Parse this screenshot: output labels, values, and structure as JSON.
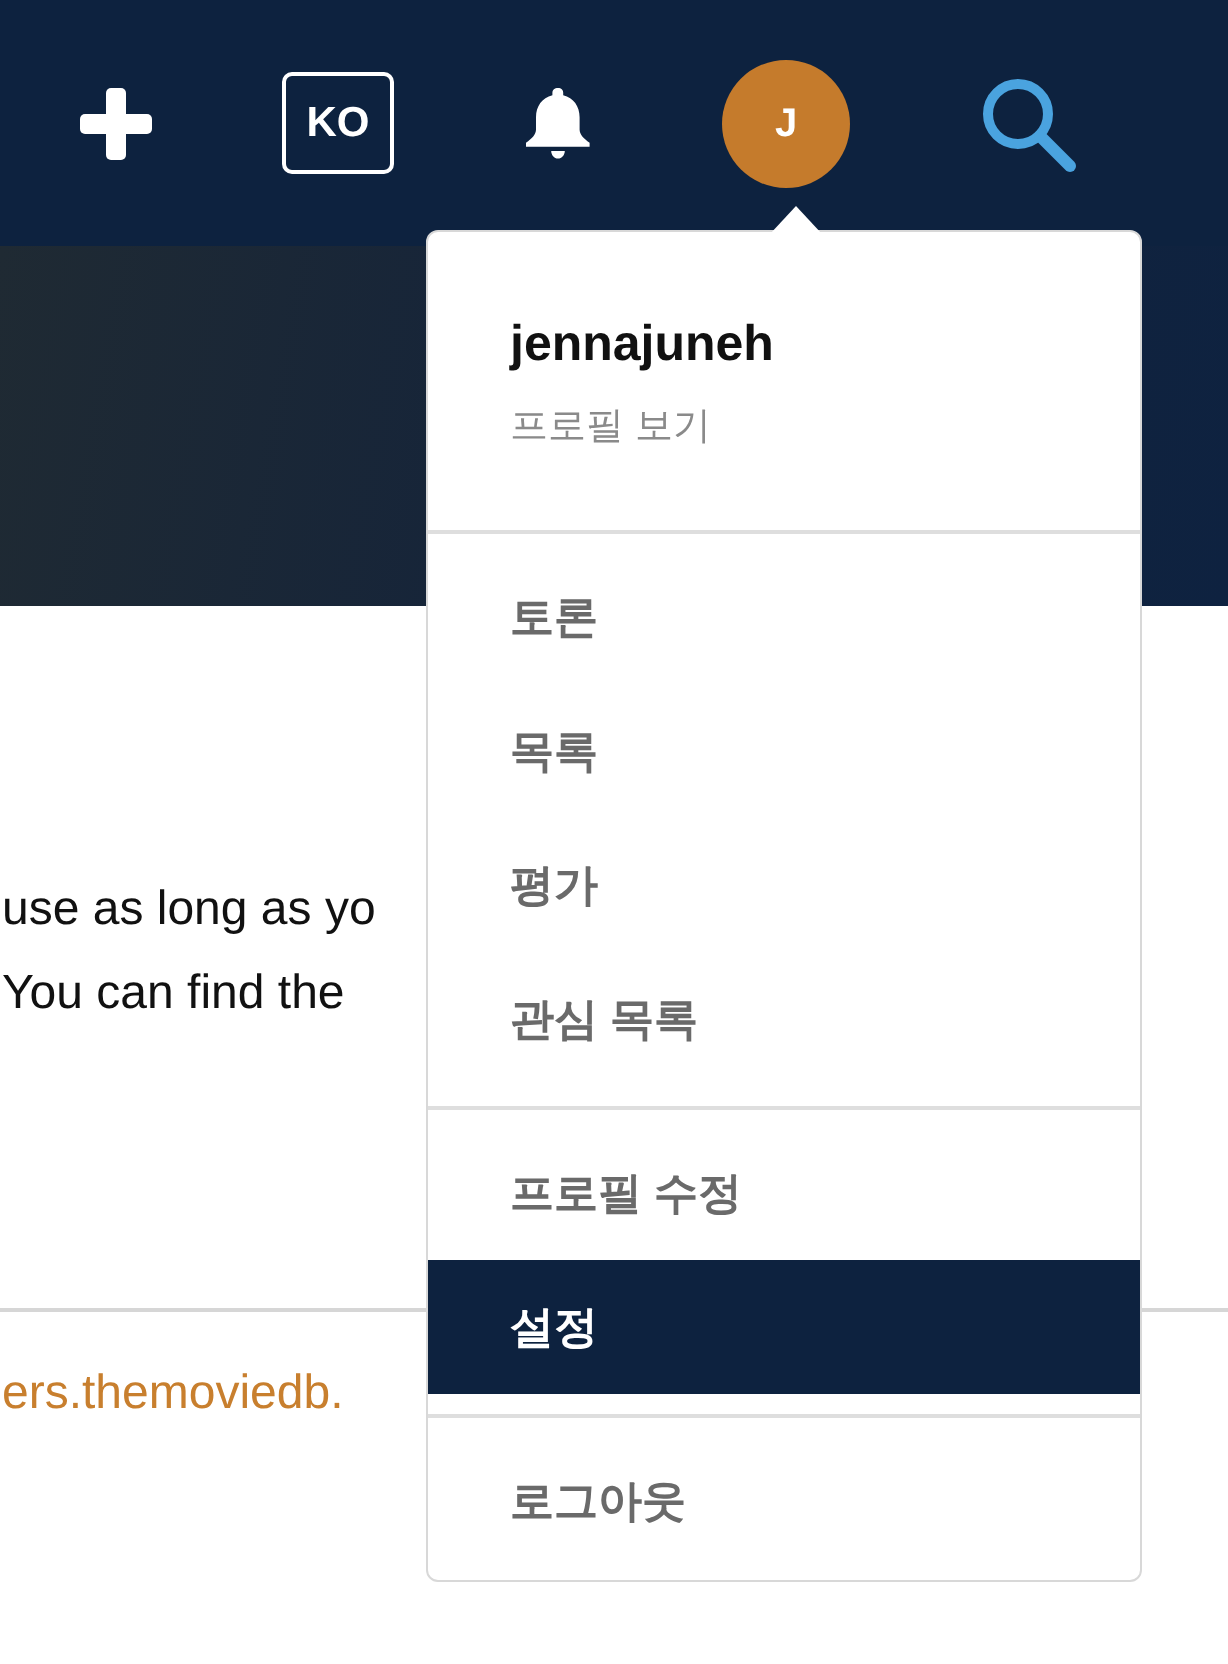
{
  "top_bar": {
    "language": "KO",
    "avatar_initial": "J"
  },
  "page_text": {
    "lines": [
      "use as long as yo",
      "You can find the"
    ],
    "link": "ers.themoviedb."
  },
  "user_menu": {
    "username": "jennajuneh",
    "profile_link": "프로필 보기",
    "groups": [
      {
        "items": [
          {
            "label": "토론",
            "selected": false
          },
          {
            "label": "목록",
            "selected": false
          },
          {
            "label": "평가",
            "selected": false
          },
          {
            "label": "관심 목록",
            "selected": false
          }
        ]
      },
      {
        "items": [
          {
            "label": "프로필 수정",
            "selected": false
          },
          {
            "label": "설정",
            "selected": true
          }
        ]
      },
      {
        "items": [
          {
            "label": "로그아웃",
            "selected": false
          }
        ]
      }
    ]
  }
}
